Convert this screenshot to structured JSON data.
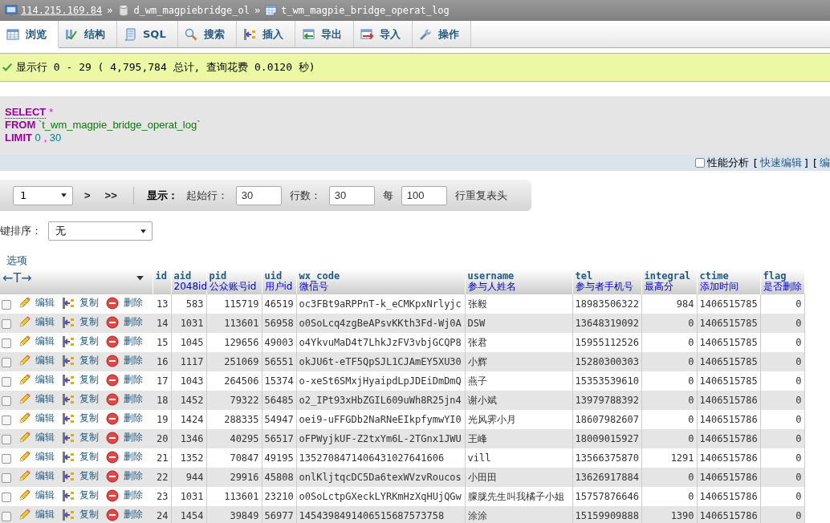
{
  "breadcrumb": [
    {
      "kind": "server",
      "text": "114.215.169.84"
    },
    {
      "kind": "database",
      "sep": "»",
      "text": "d_wm_magpiebridge_ol"
    },
    {
      "kind": "table",
      "sep": "»",
      "text": "t_wm_magpie_bridge_operat_log"
    }
  ],
  "tabs": [
    {
      "kind": "browse",
      "label": "浏览",
      "selected": true
    },
    {
      "kind": "structure",
      "label": "结构",
      "selected": false
    },
    {
      "kind": "sql",
      "label": "SQL",
      "selected": false
    },
    {
      "kind": "search",
      "label": "搜索",
      "selected": false
    },
    {
      "kind": "insert",
      "label": "插入",
      "selected": false
    },
    {
      "kind": "export",
      "label": "导出",
      "selected": false
    },
    {
      "kind": "import",
      "label": "导入",
      "selected": false
    },
    {
      "kind": "operations",
      "label": "操作",
      "selected": false
    }
  ],
  "message": "显示行 0 - 29 ( 4,795,784 总计, 查询花费 0.0120 秒)",
  "sql": [
    {
      "keyword": "SELECT",
      "parts": [
        {
          "kind": "operator",
          "text": "*"
        }
      ]
    },
    {
      "keyword": "FROM",
      "parts": [
        {
          "kind": "identifier",
          "text": "`t_wm_magpie_bridge_operat_log`"
        }
      ]
    },
    {
      "keyword": "LIMIT",
      "parts": [
        {
          "kind": "number",
          "text": "0"
        },
        {
          "kind": "punct",
          "text": ","
        },
        {
          "kind": "number",
          "text": "30"
        }
      ]
    }
  ],
  "query_bar": {
    "profiling": {
      "label": "性能分析",
      "checked": false
    },
    "links": [
      {
        "open": "[",
        "text": "快速编辑",
        "close": "]"
      },
      {
        "open": "[",
        "text": "编"
      }
    ]
  },
  "navigation": {
    "page": "1",
    "next": ">",
    "last": ">>",
    "show_label": "显示：",
    "start_label": "起始行：",
    "start": "30",
    "rows_label": "行数：",
    "rows": "30",
    "every_label": "每",
    "every": "100",
    "repeat_label": "行重复表头"
  },
  "sort": {
    "label": "键排序：",
    "value": "无"
  },
  "options_link": "选项",
  "table": {
    "handle": "←T→",
    "columns": [
      {
        "name": "id"
      },
      {
        "name": "aid",
        "comment": "2048id"
      },
      {
        "name": "pid",
        "comment": "公众账号id"
      },
      {
        "name": "uid",
        "comment": "用户id"
      },
      {
        "name": "wx_code",
        "comment": "微信号"
      },
      {
        "name": "username",
        "comment": "参与人姓名"
      },
      {
        "name": "tel",
        "comment": "参与者手机号"
      },
      {
        "name": "integral",
        "comment": "最高分"
      },
      {
        "name": "ctime",
        "comment": "添加时间"
      },
      {
        "name": "flag",
        "comment": "是否删除"
      }
    ],
    "rows": [
      {
        "checked": false,
        "actions": [
          "编辑",
          "复制",
          "删除"
        ],
        "cells": [
          "13",
          "583",
          "115719",
          "46519",
          "oc3FBt9aRPPnT-k_eCMKpxNrlyjc",
          "张毅",
          "18983506322",
          "984",
          "1406515785",
          "0"
        ]
      },
      {
        "checked": false,
        "actions": [
          "编辑",
          "复制",
          "删除"
        ],
        "cells": [
          "14",
          "1031",
          "113601",
          "56958",
          "o0SoLcq4zgBeAPsvKKth3Fd-Wj0A",
          "DSW",
          "13648319092",
          "0",
          "1406515785",
          "0"
        ]
      },
      {
        "checked": false,
        "actions": [
          "编辑",
          "复制",
          "删除"
        ],
        "cells": [
          "15",
          "1045",
          "129656",
          "49003",
          "o4YkvuMaD4t7LhkJzFV3vbjGCQP8",
          "张君",
          "15955112526",
          "0",
          "1406515785",
          "0"
        ]
      },
      {
        "checked": false,
        "actions": [
          "编辑",
          "复制",
          "删除"
        ],
        "cells": [
          "16",
          "1117",
          "251069",
          "56551",
          "okJU6t-eTF5QpSJL1CJAmEY5XU30",
          "小辉",
          "15280300303",
          "0",
          "1406515785",
          "0"
        ]
      },
      {
        "checked": false,
        "actions": [
          "编辑",
          "复制",
          "删除"
        ],
        "cells": [
          "17",
          "1043",
          "264506",
          "15374",
          "o-xeSt6SMxjHyaipdLpJDEiDmDmQ",
          "燕子",
          "15353539610",
          "0",
          "1406515785",
          "0"
        ]
      },
      {
        "checked": false,
        "actions": [
          "编辑",
          "复制",
          "删除"
        ],
        "cells": [
          "18",
          "1452",
          "79322",
          "56485",
          "o2_IPt93xHbZGIL609uWh8R25jn4",
          "谢小斌",
          "13979788392",
          "0",
          "1406515786",
          "0"
        ]
      },
      {
        "checked": false,
        "actions": [
          "编辑",
          "复制",
          "删除"
        ],
        "cells": [
          "19",
          "1424",
          "288335",
          "54947",
          "oei9-uFFGDb2NaRNeEIkpfymwYI0",
          "光风霁小月",
          "18607982607",
          "0",
          "1406515786",
          "0"
        ]
      },
      {
        "checked": false,
        "actions": [
          "编辑",
          "复制",
          "删除"
        ],
        "cells": [
          "20",
          "1346",
          "40295",
          "56517",
          "oFPWyjkUF-Z2txYm6L-2TGnx1JWU",
          "王峰",
          "18009015927",
          "0",
          "1406515786",
          "0"
        ]
      },
      {
        "checked": false,
        "actions": [
          "编辑",
          "复制",
          "删除"
        ],
        "cells": [
          "21",
          "1352",
          "70847",
          "49195",
          "1352708471406431027641606",
          "vill",
          "13566375870",
          "1291",
          "1406515786",
          "0"
        ]
      },
      {
        "checked": false,
        "actions": [
          "编辑",
          "复制",
          "删除"
        ],
        "cells": [
          "22",
          "944",
          "29916",
          "45808",
          "onlKljtqcDC5Da6texWVzvRoucos",
          "小田田",
          "13626917884",
          "0",
          "1406515786",
          "0"
        ]
      },
      {
        "checked": false,
        "actions": [
          "编辑",
          "复制",
          "删除"
        ],
        "cells": [
          "23",
          "1031",
          "113601",
          "23210",
          "o0SoLctpGXeckLYRKmHzXqHUjQGw",
          "朦胧先生叫我橘子小姐",
          "15757876646",
          "0",
          "1406515786",
          "0"
        ]
      },
      {
        "checked": false,
        "actions": [
          "编辑",
          "复制",
          "删除"
        ],
        "cells": [
          "24",
          "1454",
          "39849",
          "56977",
          "1454398491406515687573758",
          "涂涂",
          "15159909888",
          "1390",
          "1406515786",
          "0"
        ]
      }
    ]
  }
}
